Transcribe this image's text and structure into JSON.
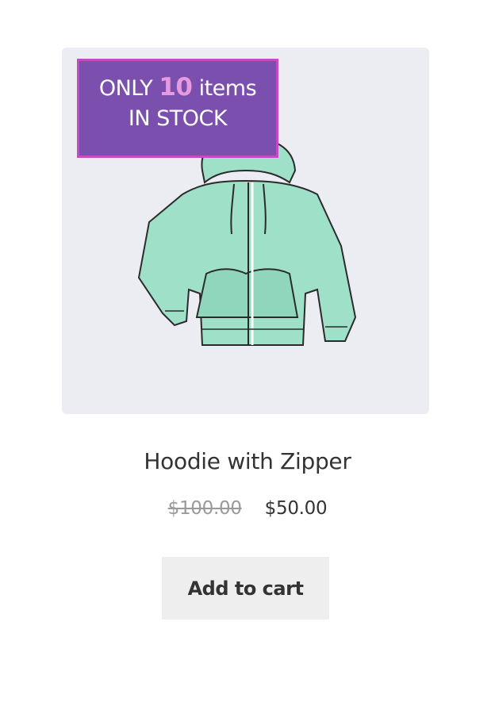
{
  "badge": {
    "prefix": "ONLY",
    "quantity": "10",
    "suffix": "items",
    "line2": "IN STOCK",
    "background_color": "#7b4fae",
    "border_color": "#c44bc4",
    "quantity_color": "#e89ae0"
  },
  "product": {
    "image_icon": "hoodie-illustration",
    "title": "Hoodie with Zipper",
    "price_regular": "$100.00",
    "price_sale": "$50.00",
    "add_to_cart_label": "Add to cart"
  },
  "colors": {
    "image_background": "#ebedf3",
    "hoodie_fill": "#9fe0c9",
    "button_background": "#eeeeee",
    "old_price": "#9a9a9a"
  }
}
